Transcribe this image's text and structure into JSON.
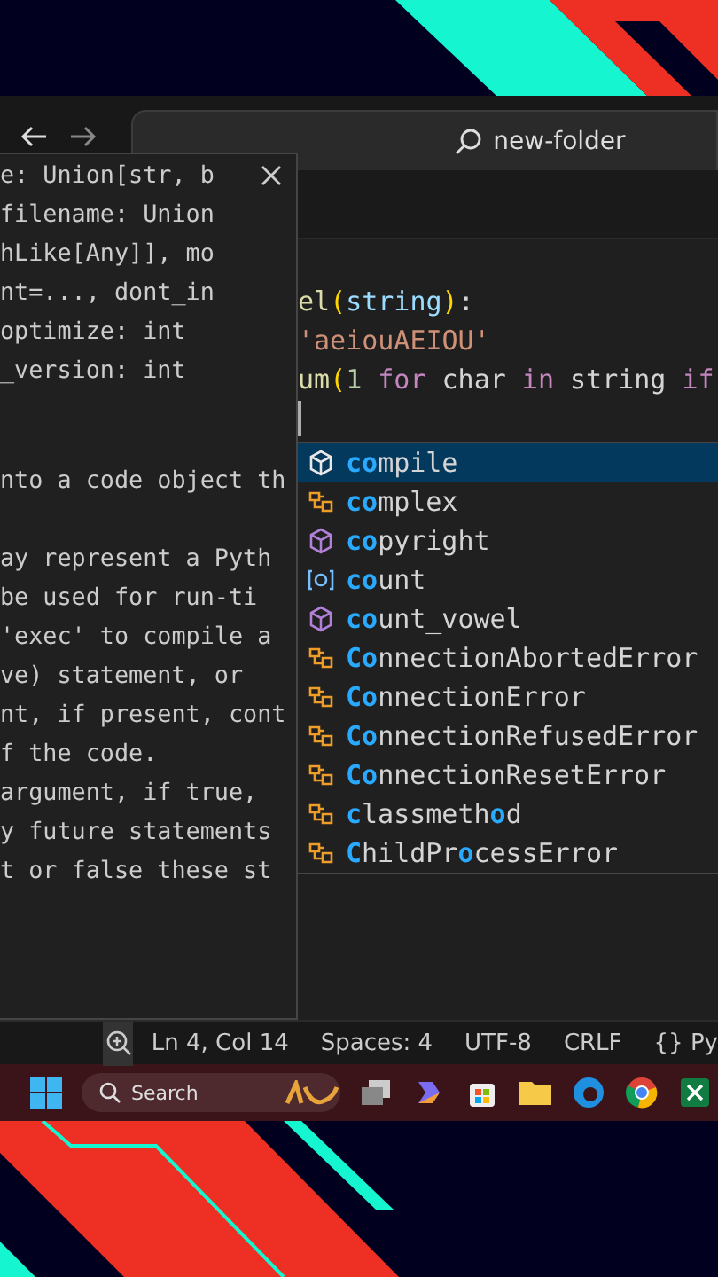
{
  "title_bar": {
    "search": "new-folder"
  },
  "hover": {
    "signature": [
      "e: Union[str, b",
      "filename: Union",
      "hLike[Any]], mo",
      "nt=..., dont_in",
      "optimize: int",
      "_version: int"
    ],
    "doc_intro": [
      "nto a code object th"
    ],
    "doc": [
      "ay represent a Pyth",
      "be used for run-ti",
      "'exec' to compile a",
      "ve) statement, or",
      "nt, if present, cont",
      "f the code.",
      "argument, if true,",
      "y future statements",
      "t or false these st"
    ]
  },
  "editor": {
    "lines": [
      [
        {
          "text": "el",
          "kind": "fn"
        },
        {
          "text": "(",
          "kind": "paren"
        },
        {
          "text": "string",
          "kind": "param"
        },
        {
          "text": ")",
          "kind": "paren"
        },
        {
          "text": ":",
          "kind": "plain"
        }
      ],
      [
        {
          "text": "'aeiouAEIOU'",
          "kind": "string"
        }
      ],
      [
        {
          "text": "um",
          "kind": "fn"
        },
        {
          "text": "(",
          "kind": "paren"
        },
        {
          "text": "1",
          "kind": "number"
        },
        {
          "text": " for ",
          "kind": "keyword"
        },
        {
          "text": "char",
          "kind": "plain"
        },
        {
          "text": " in ",
          "kind": "keyword"
        },
        {
          "text": "string",
          "kind": "plain"
        },
        {
          "text": " if",
          "kind": "keyword"
        }
      ]
    ]
  },
  "suggestions": [
    {
      "label": "**co**mpile",
      "kind": "function",
      "selected": true
    },
    {
      "label": "**co**mplex",
      "kind": "class",
      "selected": false
    },
    {
      "label": "**co**pyright",
      "kind": "module",
      "selected": false
    },
    {
      "label": "**co**unt",
      "kind": "variable",
      "selected": false
    },
    {
      "label": "**co**unt_vowel",
      "kind": "module",
      "selected": false
    },
    {
      "label": "**Co**nnectionAbortedError",
      "kind": "class",
      "selected": false
    },
    {
      "label": "**Co**nnectionError",
      "kind": "class",
      "selected": false
    },
    {
      "label": "**Co**nnectionRefusedError",
      "kind": "class",
      "selected": false
    },
    {
      "label": "**Co**nnectionResetError",
      "kind": "class",
      "selected": false
    },
    {
      "label": "**c**lassmeth**o**d",
      "kind": "class",
      "selected": false
    },
    {
      "label": "**C**hildPr**o**cessError",
      "kind": "class",
      "selected": false
    }
  ],
  "status_bar": [
    "Ln 4, Col 14",
    "Spaces: 4",
    "UTF-8",
    "CRLF",
    "{} Py"
  ],
  "taskbar": {
    "search_placeholder": "Search"
  }
}
